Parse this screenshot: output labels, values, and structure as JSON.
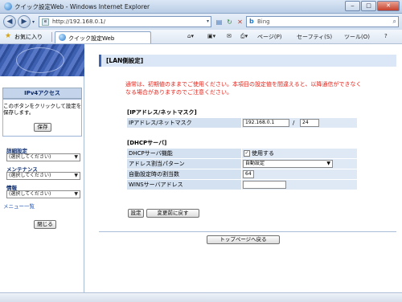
{
  "window": {
    "title": "クイック設定Web - Windows Internet Explorer"
  },
  "address": {
    "url": "http://192.168.0.1/",
    "search_provider": "Bing"
  },
  "favorites": {
    "label": "お気に入り",
    "tab_title": "クイック設定Web"
  },
  "command_bar": {
    "page": "ページ(P)",
    "safety": "セーフティ(S)",
    "tools": "ツール(O)",
    "help": "?"
  },
  "sidebar": {
    "header": "IPv4アクセス",
    "note": "このボタンをクリックして設定を保存します。",
    "save_label": "保存",
    "sections": [
      {
        "label": "詳細設定",
        "select": "(選択してください)"
      },
      {
        "label": "メンテナンス",
        "select": "(選択してください)"
      },
      {
        "label": "情報",
        "select": "(選択してください)"
      }
    ],
    "menu_list": "メニュー一覧",
    "close_label": "閉じる"
  },
  "main": {
    "title": "[LAN側設定]",
    "notice": "通常は、初期値のままでご使用ください。本項目の設定値を間違えると、以降通信ができなくなる場合がありますのでご注意ください。",
    "ip_section": {
      "heading": "[IPアドレス/ネットマスク]",
      "row_label": "IPアドレス/ネットマスク",
      "ip_value": "192.168.0.1",
      "separator": "/",
      "mask_value": "24"
    },
    "dhcp_section": {
      "heading": "[DHCPサーバ]",
      "rows": [
        {
          "label": "DHCPサーバ機能",
          "checkbox_label": "使用する",
          "checked": true
        },
        {
          "label": "アドレス割当パターン",
          "select": "自動設定"
        },
        {
          "label": "自動設定時の割当数",
          "value": "64"
        },
        {
          "label": "WINSサーバアドレス",
          "value": ""
        }
      ]
    },
    "set_label": "設定",
    "revert_label": "変更前に戻す",
    "top_label": "トップページへ戻る"
  }
}
